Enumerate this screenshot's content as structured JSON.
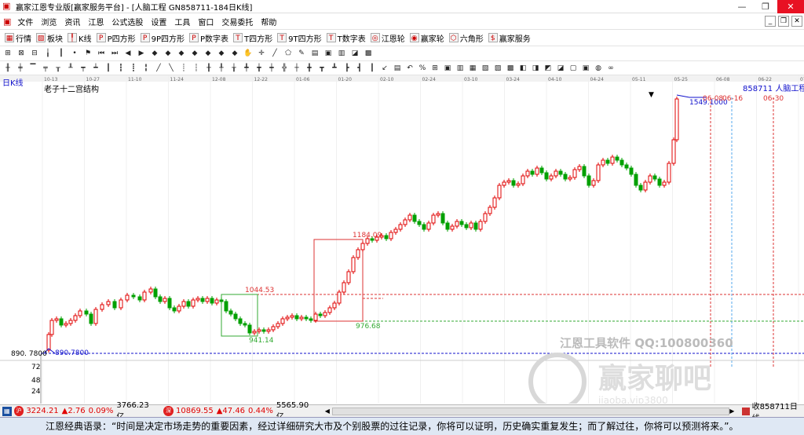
{
  "window": {
    "title": "赢家江恩专业版[赢家服务平台] - [人脑工程  GN858711-184日K线]"
  },
  "menu": {
    "items": [
      "文件",
      "浏览",
      "资讯",
      "江恩",
      "公式选股",
      "设置",
      "工具",
      "窗口",
      "交易委托",
      "帮助"
    ]
  },
  "toolbar1": {
    "items": [
      "行情",
      "板块",
      "K线",
      "P四方形",
      "9P四方形",
      "P数字表",
      "T四方形",
      "9T四方形",
      "T数字表",
      "江恩轮",
      "赢家轮",
      "六角形",
      "赢家服务"
    ]
  },
  "chart": {
    "period_label": "日K线",
    "indicator_title": "老子十二宫结构",
    "code_name": "858711  人脑工程",
    "date_ticks": [
      "10-13",
      "10-27",
      "11-10",
      "11-24",
      "12-08",
      "12-22",
      "01-06",
      "01-20",
      "02-10",
      "02-24",
      "03-10",
      "03-24",
      "04-10",
      "04-24",
      "05-11",
      "05-25",
      "06-08",
      "06-22",
      "07-06"
    ],
    "annotations": {
      "top_price": "1549.1000",
      "top_date1": "06-08",
      "top_date2": "06-16",
      "top_date3": "06-30",
      "box2_high": "1184.09",
      "box1_high": "1044.53",
      "box2_low": "976.68",
      "box1_low": "941.14",
      "base_price": "890.7800",
      "base_axis": "890. 7800"
    },
    "volume_axis": [
      "72",
      "48",
      "24"
    ],
    "watermark_line1": "江恩工具软件  QQ:100800360",
    "watermark_line2": "赢家聊吧",
    "watermark_line3": "jiaoba.vip3800",
    "colors": {
      "up": "#e00000",
      "down": "#00a000",
      "box_green": "#33aa33",
      "box_red": "#dd3333",
      "blue_line": "#1010cc"
    }
  },
  "status": {
    "sh_index": "3224.21",
    "sh_change": "▲2.76",
    "sh_pct": "0.09%",
    "sh_amount": "3766.23亿",
    "sz_index": "10869.55",
    "sz_change": "▲47.46",
    "sz_pct": "0.44%",
    "sz_amount": "5565.90亿",
    "right_text": "收858711日线"
  },
  "quote": {
    "text": "江恩经典语录：“时间是决定市场走势的重要因素，经过详细研究大市及个别股票的过往记录，你将可以证明，历史确实重复发生；而了解过往，你将可以预测将来。”。"
  }
}
